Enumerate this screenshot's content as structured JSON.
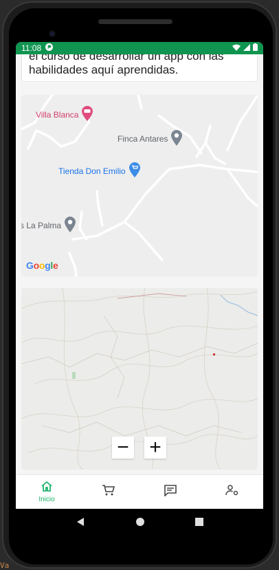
{
  "status_bar": {
    "time": "11:08"
  },
  "content": {
    "text_lines": [
      "el curso de desarrollar un app con las",
      "habilidades aquí aprendidas."
    ]
  },
  "map_top": {
    "places": {
      "villa": "Villa Blanca",
      "finca": "Finca Antares",
      "tienda": "Tienda Don Emilio",
      "palma": "s La Palma"
    },
    "attribution": [
      "G",
      "o",
      "o",
      "g",
      "l",
      "e"
    ]
  },
  "map_bottom": {
    "zoom_out": "−",
    "zoom_in": "+"
  },
  "bottom_nav": {
    "items": [
      {
        "label": "Inicio",
        "icon": "home-icon",
        "active": true
      },
      {
        "label": "",
        "icon": "cart-icon",
        "active": false
      },
      {
        "label": "",
        "icon": "chat-icon",
        "active": false
      },
      {
        "label": "",
        "icon": "user-settings-icon",
        "active": false
      }
    ]
  },
  "colors": {
    "accent": "#1db36b",
    "status_bar": "#109551"
  },
  "overlay": {
    "text": "Va"
  }
}
